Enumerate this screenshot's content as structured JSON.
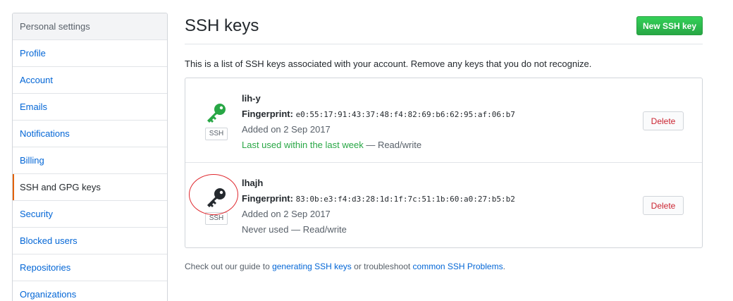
{
  "sidebar": {
    "header": "Personal settings",
    "items": [
      {
        "label": "Profile"
      },
      {
        "label": "Account"
      },
      {
        "label": "Emails"
      },
      {
        "label": "Notifications"
      },
      {
        "label": "Billing"
      },
      {
        "label": "SSH and GPG keys"
      },
      {
        "label": "Security"
      },
      {
        "label": "Blocked users"
      },
      {
        "label": "Repositories"
      },
      {
        "label": "Organizations"
      }
    ],
    "selected": "SSH and GPG keys"
  },
  "main": {
    "title": "SSH keys",
    "new_key_button": "New SSH key",
    "intro": "This is a list of SSH keys associated with your account. Remove any keys that you do not recognize.",
    "keys": [
      {
        "name": "lih-y",
        "fingerprint_label": "Fingerprint:",
        "fingerprint": "e0:55:17:91:43:37:48:f4:82:69:b6:62:95:af:06:b7",
        "added": "Added on 2 Sep 2017",
        "used_highlight": "Last used within the last week",
        "used_rest": " — Read/write",
        "badge": "SSH",
        "icon": "key-icon",
        "icon_color": "#28a745",
        "delete_label": "Delete"
      },
      {
        "name": "lhajh",
        "fingerprint_label": "Fingerprint:",
        "fingerprint": "83:0b:e3:f4:d3:28:1d:1f:7c:51:1b:60:a0:27:b5:b2",
        "added": "Added on 2 Sep 2017",
        "used_highlight": "",
        "used_rest": "Never used — Read/write",
        "badge": "SSH",
        "icon": "key-icon",
        "icon_color": "#24292e",
        "delete_label": "Delete"
      }
    ]
  },
  "footer": {
    "prefix": "Check out our guide to ",
    "link1": "generating SSH keys",
    "middle": " or troubleshoot ",
    "link2": "common SSH Problems",
    "suffix": "."
  },
  "colors": {
    "accent_orange": "#e36209",
    "link_blue": "#0366d6",
    "green": "#28a745",
    "danger_red": "#cb2431",
    "annotation_red": "#e0282e"
  }
}
